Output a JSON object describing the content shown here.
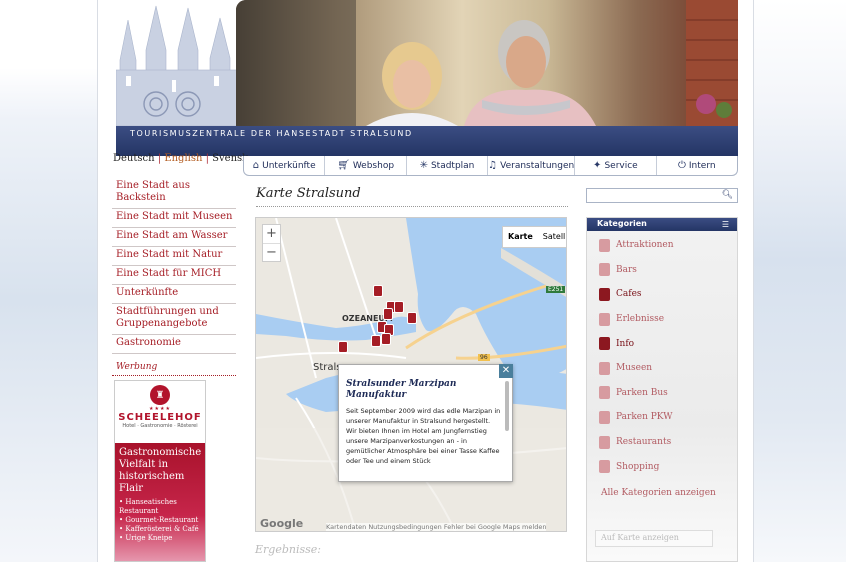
{
  "header": {
    "banner_text": "TOURISMUSZENTRALE DER  HANSESTADT STRALSUND"
  },
  "languages": [
    "Deutsch",
    "English",
    "Svensk"
  ],
  "nav": [
    {
      "label": "Unterkünfte",
      "icon": "house-icon"
    },
    {
      "label": "Webshop",
      "icon": "cart-icon"
    },
    {
      "label": "Stadtplan",
      "icon": "compass-icon"
    },
    {
      "label": "Veranstaltungen",
      "icon": "music-icon"
    },
    {
      "label": "Service",
      "icon": "star-icon"
    },
    {
      "label": "Intern",
      "icon": "power-icon"
    }
  ],
  "left_menu": [
    "Eine Stadt aus Backstein",
    "Eine Stadt mit Museen",
    "Eine Stadt am Wasser",
    "Eine Stadt mit Natur",
    "Eine Stadt für MICH",
    "Unterkünfte",
    "Stadtführungen und Gruppenangebote",
    "Gastronomie"
  ],
  "werbung_label": "Werbung",
  "ad": {
    "stars": "★★★★",
    "brand": "SCHEELEHOF",
    "subtitle": "Hotel · Gastronomie · Rösterei",
    "headline": "Gastronomische Vielfalt in historischem Flair",
    "bullets": [
      "Hanseatisches Restaurant",
      "Gourmet-Restaurant",
      "Kafferösterei & Café",
      "Urige Kneipe"
    ]
  },
  "page_title": "Karte Stralsund",
  "map": {
    "zoom_in": "+",
    "zoom_out": "−",
    "type_map": "Karte",
    "type_satellite": "Satellit",
    "labels": {
      "ozeaneum": "OZEANEUM",
      "strals": "Strals",
      "e251": "E251",
      "r96": "96"
    },
    "google": "Google",
    "attribution": "Kartendaten   Nutzungsbedingungen   Fehler bei Google Maps melden",
    "popup": {
      "close": "✕",
      "title": "Stralsunder Marzipan Manufaktur",
      "text": "Seit September 2009 wird das edle Marzipan in unserer Manufaktur in Stralsund hergestellt. Wir bieten Ihnen im Hotel am Jungfernstieg unsere Marzipanverkostungen an - in gemütlicher Atmosphäre bei einer Tasse Kaffee oder Tee und einem Stück"
    }
  },
  "results_label": "Ergebnisse:",
  "sidebar": {
    "search_placeholder": "",
    "categories_title": "Kategorien",
    "categories": [
      {
        "label": "Attraktionen",
        "active": false
      },
      {
        "label": "Bars",
        "active": false
      },
      {
        "label": "Cafes",
        "active": true
      },
      {
        "label": "Erlebnisse",
        "active": false
      },
      {
        "label": "Info",
        "active": true
      },
      {
        "label": "Museen",
        "active": false
      },
      {
        "label": "Parken Bus",
        "active": false
      },
      {
        "label": "Parken PKW",
        "active": false
      },
      {
        "label": "Restaurants",
        "active": false
      },
      {
        "label": "Shopping",
        "active": false
      }
    ],
    "show_all": "Alle Kategorien anzeigen",
    "address_placeholder": "Auf Karte anzeigen"
  },
  "colors": {
    "navy": "#243565",
    "red": "#a51d25",
    "pin_light": "#d79ba0"
  }
}
